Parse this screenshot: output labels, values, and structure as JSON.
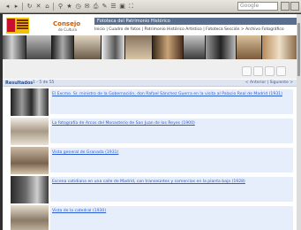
{
  "toolbar": {
    "search_placeholder": "Google"
  },
  "header": {
    "brand": "Consejo",
    "brand_sub": "de Cultura",
    "title_bar": "Fototeca del Patrimonio Histórico",
    "breadcrumb": "Inicio | Cuadro de fotos | Patrimonio Histórico Artístico | Fototeca Sección > Archivo Fotográfico"
  },
  "results": {
    "label": "Resultados",
    "count": "1 - 5 de 55",
    "pager": "< Anterior | Siguiente >"
  },
  "rows": [
    {
      "title": "El Excmo. Sr. ministro de la Gobernación, don Rafael Sánchez Guerra en la visita al Palacio Real de Madrid (1931)"
    },
    {
      "title": "La fotografía de Arcos del Monasterio de San Juan de los Reyes (1900)"
    },
    {
      "title": "Vista general de Granada (1931)"
    },
    {
      "title": "Escena cotidiana en una calle de Madrid, con transeúntes y comercios en la planta baja (1928)"
    },
    {
      "title": "Vista de la catedral (1930)"
    }
  ]
}
